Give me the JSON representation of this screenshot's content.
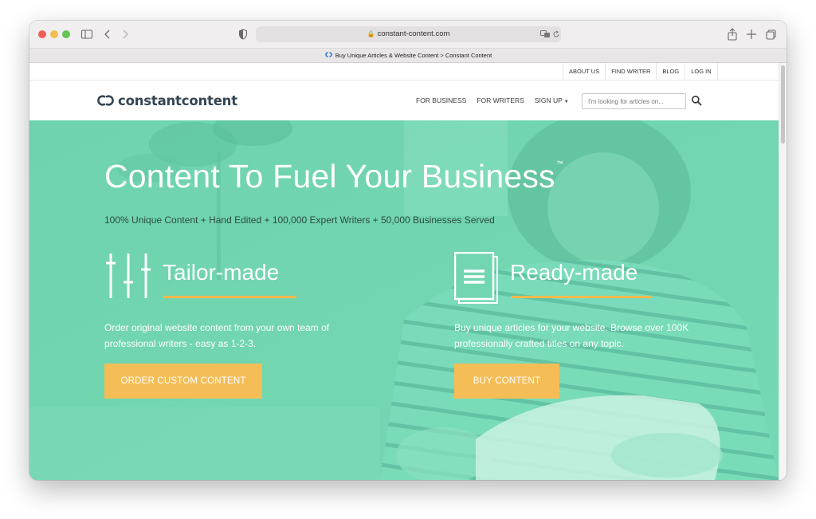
{
  "browser": {
    "url": "constant-content.com",
    "tab_title": "Buy Unique Articles & Website Content > Constant Content"
  },
  "top_nav": {
    "items": [
      {
        "label": "ABOUT US"
      },
      {
        "label": "FIND WRITER"
      },
      {
        "label": "BLOG"
      },
      {
        "label": "LOG IN"
      }
    ]
  },
  "main_nav": {
    "logo_text": "constantcontent",
    "links": [
      {
        "label": "FOR BUSINESS"
      },
      {
        "label": "FOR WRITERS"
      },
      {
        "label": "SIGN UP"
      }
    ],
    "search_placeholder": "I'm looking for articles on..."
  },
  "hero": {
    "headline": "Content To Fuel Your Business",
    "trademark": "™",
    "subheadline": "100% Unique Content + Hand Edited + 100,000 Expert Writers + 50,000 Businesses Served",
    "tailor": {
      "title": "Tailor-made",
      "description": "Order original website content from your own team of professional writers - easy as 1-2-3.",
      "button": "ORDER CUSTOM CONTENT"
    },
    "ready": {
      "title": "Ready-made",
      "description": "Buy unique articles for your website. Browse over 100K professionally crafted titles on any topic.",
      "button": "BUY CONTENT"
    }
  },
  "colors": {
    "brand_green": "#72d6b1",
    "accent_yellow": "#f5bd55",
    "logo_dark": "#344552"
  }
}
